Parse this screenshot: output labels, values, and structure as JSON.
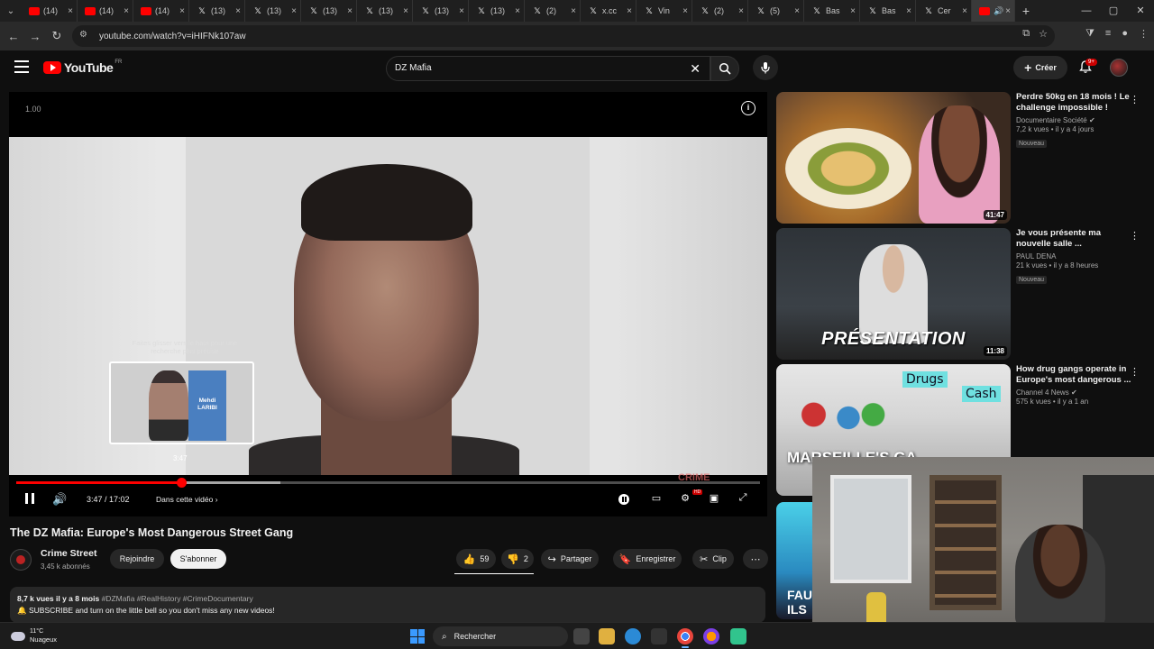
{
  "browser": {
    "tabs": [
      {
        "title": "(14)",
        "icon": "youtube-icon"
      },
      {
        "title": "(14)",
        "icon": "youtube-icon"
      },
      {
        "title": "(14)",
        "icon": "youtube-icon"
      },
      {
        "title": "(13)",
        "icon": "x-icon"
      },
      {
        "title": "(13)",
        "icon": "x-icon"
      },
      {
        "title": "(13)",
        "icon": "x-icon"
      },
      {
        "title": "(13)",
        "icon": "x-icon"
      },
      {
        "title": "(13)",
        "icon": "x-icon"
      },
      {
        "title": "(13)",
        "icon": "x-icon"
      },
      {
        "title": "(2)",
        "icon": "x-icon"
      },
      {
        "title": "x.cc",
        "icon": "x-icon"
      },
      {
        "title": "Vin",
        "icon": "x-icon"
      },
      {
        "title": "(2)",
        "icon": "x-icon"
      },
      {
        "title": "(5)",
        "icon": "x-icon"
      },
      {
        "title": "Bas",
        "icon": "x-icon"
      },
      {
        "title": "Bas",
        "icon": "x-icon"
      },
      {
        "title": "Cer",
        "icon": "x-icon"
      }
    ],
    "url": "youtube.com/watch?v=iHIFNk107aw"
  },
  "header": {
    "logo_text": "YouTube",
    "logo_country": "FR",
    "search_query": "DZ Mafia",
    "create_label": "Créer",
    "notif_count": "9+"
  },
  "player": {
    "speed_text": "1.00",
    "hint_text": "Faites glisser vers le haut pour une recherche plus précise",
    "preview_name": "Mehdi LARIBI",
    "preview_time": "3:47",
    "watermark": "CRIME",
    "time_display": "3:47 / 17:02",
    "chapter_label": "Dans cette vidéo",
    "played_fraction": 0.222,
    "loaded_fraction": 0.355
  },
  "video": {
    "title": "The DZ Mafia: Europe's Most Dangerous Street Gang",
    "channel": "Crime Street",
    "subscribers": "3,45 k abonnés",
    "join_label": "Rejoindre",
    "subscribe_label": "S'abonner",
    "likes": "59",
    "dislikes": "2",
    "share_label": "Partager",
    "save_label": "Enregistrer",
    "clip_label": "Clip",
    "views_date": "8,7 k vues  il y a 8 mois",
    "hashtags": "#DZMafia #RealHistory #CrimeDocumentary",
    "desc_line": "SUBSCRIBE and turn on the little bell so you don't miss any new videos!"
  },
  "recommendations": [
    {
      "title": "Perdre 50kg en 18 mois ! Le challenge impossible !",
      "channel": "Documentaire Société",
      "stats": "7,2 k vues • il y a 4 jours",
      "badge": "Nouveau",
      "duration": "41:47"
    },
    {
      "title": "Je vous présente ma nouvelle salle ...",
      "channel": "PAUL DENA",
      "stats": "21 k vues • il y a 8 heures",
      "badge": "Nouveau",
      "duration": "11:38",
      "overlay": "PRÉSENTATION"
    },
    {
      "title": "How drug gangs operate in Europe's most dangerous ...",
      "channel": "Channel 4 News",
      "stats": "575 k vues • il y a 1 an",
      "badge": "",
      "duration": "",
      "tag1": "Drugs",
      "tag2": "Cash",
      "overlay": "MARSEILLE'S GA"
    }
  ],
  "partial_thumb_text": "FAU ILS",
  "taskbar": {
    "temperature": "11°C",
    "weather": "Nuageux",
    "search_placeholder": "Rechercher"
  },
  "colors": {
    "accent": "#ff0000",
    "background": "#0f0f0f",
    "pill": "#272727"
  }
}
